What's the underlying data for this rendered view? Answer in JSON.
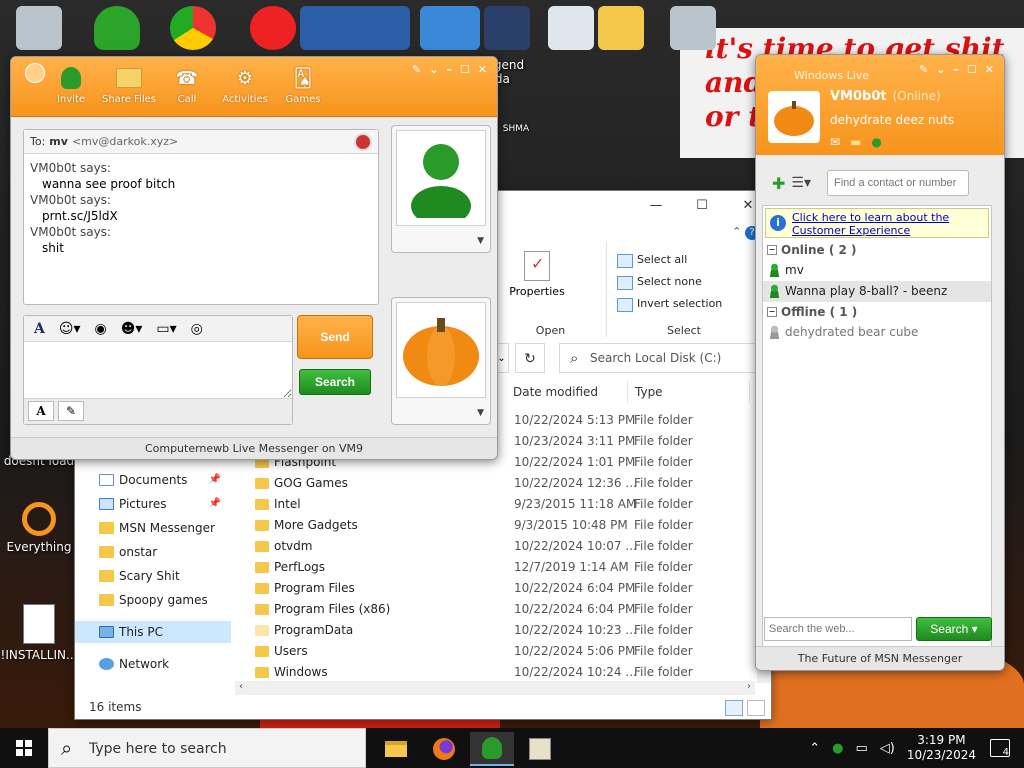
{
  "desktop": {
    "wallpaper_text": "it's time to get shit\nand\nor t",
    "icons": [
      {
        "label": "doesnt load",
        "id": "doesnt-load"
      },
      {
        "label": "Everything",
        "id": "everything"
      },
      {
        "label": "!INSTALLIN...",
        "id": "installing"
      },
      {
        "label": "Legend Zilda",
        "id": "legend-zilda"
      }
    ],
    "wallpaper_logo": "SHMA"
  },
  "chat": {
    "toolbar": [
      {
        "label": "Invite",
        "icon": "invite-icon"
      },
      {
        "label": "Share Files",
        "icon": "folder-icon"
      },
      {
        "label": "Call",
        "icon": "phone-icon"
      },
      {
        "label": "Activities",
        "icon": "activities-icon"
      },
      {
        "label": "Games",
        "icon": "cards-icon"
      }
    ],
    "to_label": "To:",
    "to_name": "mv",
    "to_address": "<mv@darkok.xyz>",
    "messages": [
      {
        "from": "VM0b0t says:",
        "text": "wanna see proof bitch"
      },
      {
        "from": "VM0b0t says:",
        "text": "prnt.sc/J5ldX"
      },
      {
        "from": "VM0b0t says:",
        "text": "shit"
      }
    ],
    "compose_value": "",
    "send_label": "Send",
    "search_label": "Search",
    "status_bar": "Computernewb Live Messenger on VM9"
  },
  "contacts": {
    "brand": "Windows Live",
    "user_name": "VM0b0t",
    "user_status": "(Online)",
    "personal_message": "dehydrate deez nuts",
    "find_placeholder": "Find a contact or number",
    "promo_text": "Click here to learn about the Customer Experience",
    "groups": [
      {
        "title": "Online ( 2 )",
        "state": "online",
        "members": [
          {
            "name": "mv",
            "selected": false
          },
          {
            "name": "Wanna play 8-ball? - beenz",
            "selected": true
          }
        ]
      },
      {
        "title": "Offline ( 1 )",
        "state": "offline",
        "members": [
          {
            "name": "dehydrated bear cube",
            "selected": false
          }
        ]
      }
    ],
    "web_search_placeholder": "Search the web...",
    "web_search_label": "Search",
    "footer": "The Future of MSN Messenger"
  },
  "explorer": {
    "ribbon": {
      "properties": "Properties",
      "open_group": "Open",
      "select_all": "Select all",
      "select_none": "Select none",
      "invert_selection": "Invert selection",
      "select_group": "Select"
    },
    "search_placeholder": "Search Local Disk (C:)",
    "columns": {
      "date": "Date modified",
      "type": "Type"
    },
    "nav": [
      {
        "label": "Documents",
        "kind": "doc",
        "pinned": true
      },
      {
        "label": "Pictures",
        "kind": "pic",
        "pinned": true
      },
      {
        "label": "MSN Messenger",
        "kind": "folder",
        "pinned": false
      },
      {
        "label": "onstar",
        "kind": "folder",
        "pinned": false
      },
      {
        "label": "Scary Shit",
        "kind": "folder",
        "pinned": false
      },
      {
        "label": "Spoopy games",
        "kind": "folder",
        "pinned": false
      },
      {
        "label": "This PC",
        "kind": "pc",
        "pinned": false
      },
      {
        "label": "Network",
        "kind": "net",
        "pinned": false
      }
    ],
    "files": [
      {
        "name": "",
        "date": "10/22/2024 5:13 PM",
        "type": "File folder"
      },
      {
        "name": "",
        "date": "10/23/2024 3:11 PM",
        "type": "File folder"
      },
      {
        "name": "Flashpoint",
        "date": "10/22/2024 1:01 PM",
        "type": "File folder"
      },
      {
        "name": "GOG Games",
        "date": "10/22/2024 12:36 ...",
        "type": "File folder"
      },
      {
        "name": "Intel",
        "date": "9/23/2015 11:18 AM",
        "type": "File folder"
      },
      {
        "name": "More Gadgets",
        "date": "9/3/2015 10:48 PM",
        "type": "File folder"
      },
      {
        "name": "otvdm",
        "date": "10/22/2024 10:07 ...",
        "type": "File folder"
      },
      {
        "name": "PerfLogs",
        "date": "12/7/2019 1:14 AM",
        "type": "File folder"
      },
      {
        "name": "Program Files",
        "date": "10/22/2024 6:04 PM",
        "type": "File folder"
      },
      {
        "name": "Program Files (x86)",
        "date": "10/22/2024 6:04 PM",
        "type": "File folder"
      },
      {
        "name": "ProgramData",
        "date": "10/22/2024 10:23 ...",
        "type": "File folder"
      },
      {
        "name": "Users",
        "date": "10/22/2024 5:06 PM",
        "type": "File folder"
      },
      {
        "name": "Windows",
        "date": "10/22/2024 10:24 ...",
        "type": "File folder"
      }
    ],
    "status": "16 items"
  },
  "taskbar": {
    "search_placeholder": "Type here to search",
    "time": "3:19 PM",
    "date": "10/23/2024",
    "notifications": "4"
  },
  "colors": {
    "msn_orange": "#f7941d",
    "msn_green": "#1f8a1f",
    "link_blue": "#0000cc"
  }
}
